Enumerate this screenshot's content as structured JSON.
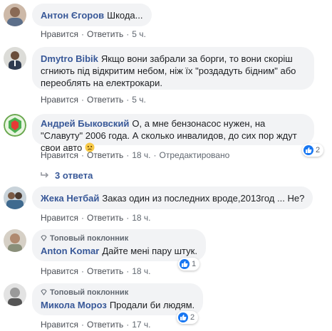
{
  "comments": [
    {
      "author": "Антон Єгоров",
      "text": "Шкода...",
      "fan_label": "",
      "like": "Нравится",
      "reply": "Ответить",
      "time": "5 ч."
    },
    {
      "author": "Dmytro Bibik",
      "text": "Якщо вони забрали за борги, то вони скоріш сгниють під відкритим небом, ніж їх \"роздадуть бідним\" або переоблять на електрокари.",
      "like": "Нравится",
      "reply": "Ответить",
      "time": "5 ч."
    },
    {
      "author": "Андрей Быковский",
      "text": "О, а мне бензонасос нужен, на \"Славуту\" 2006 года. А сколько инвалидов, до сих пор ждут свои авто",
      "emoji": "😞",
      "like": "Нравится",
      "reply": "Ответить",
      "time": "18 ч.",
      "edited": "Отредактировано",
      "reaction_count": "2",
      "replies_label": "3 ответа"
    },
    {
      "author": "Жека Нетбай",
      "text": "Заказ один из последних вроде,2013год ... Не?",
      "like": "Нравится",
      "reply": "Ответить",
      "time": "18 ч."
    },
    {
      "fan_label": "Топовый поклонник",
      "author": "Anton Komar",
      "text": "Дайте мені пару штук.",
      "like": "Нравится",
      "reply": "Ответить",
      "time": "18 ч.",
      "reaction_count": "1"
    },
    {
      "fan_label": "Топовый поклонник",
      "author": "Микола Мороз",
      "text": "Продали би людям.",
      "like": "Нравится",
      "reply": "Ответить",
      "time": "17 ч.",
      "reaction_count": "2"
    }
  ],
  "colors": {
    "author": "#385898",
    "bubble": "#f2f3f5",
    "like_badge": "#1877f2"
  },
  "icons": [
    "avatar",
    "diamond-icon",
    "like-icon",
    "reply-arrow-icon",
    "sad-emoji"
  ]
}
